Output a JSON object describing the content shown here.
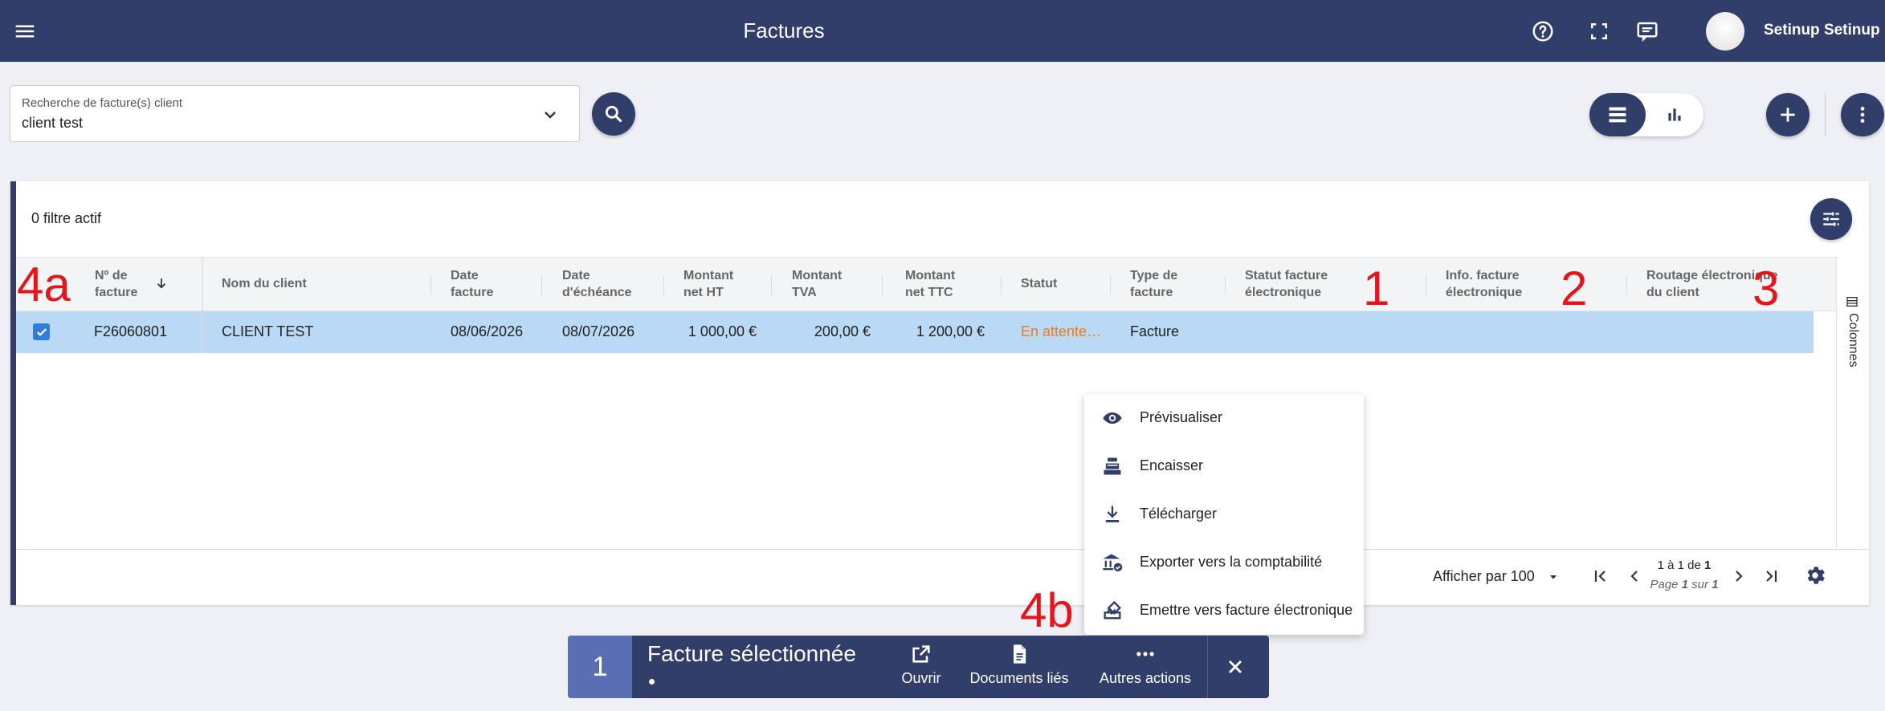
{
  "topbar": {
    "title": "Factures",
    "user_name": "Setinup Setinup",
    "icons": [
      "menu-icon",
      "help-icon",
      "fullscreen-icon",
      "chat-icon"
    ]
  },
  "search": {
    "label": "Recherche de facture(s) client",
    "value": "client test"
  },
  "filters": {
    "active_text": "0 filtre actif"
  },
  "table": {
    "headers": {
      "invoice_number": [
        "Nº de",
        "facture"
      ],
      "client_name": "Nom du client",
      "invoice_date": [
        "Date",
        "facture"
      ],
      "due_date": [
        "Date",
        "d'échéance"
      ],
      "amount_ht": [
        "Montant",
        "net HT"
      ],
      "amount_tva": [
        "Montant",
        "TVA"
      ],
      "amount_ttc": [
        "Montant",
        "net TTC"
      ],
      "status": "Statut",
      "invoice_type": [
        "Type de",
        "facture"
      ],
      "einvoice_status": [
        "Statut facture",
        "électronique"
      ],
      "einvoice_info": [
        "Info. facture",
        "électronique"
      ],
      "client_routing": [
        "Routage électronique",
        "du client"
      ]
    },
    "rows": [
      {
        "selected": true,
        "invoice_number": "F26060801",
        "client_name": "CLIENT TEST",
        "invoice_date": "08/06/2026",
        "due_date": "08/07/2026",
        "amount_ht": "1 000,00 €",
        "amount_tva": "200,00 €",
        "amount_ttc": "1 200,00 €",
        "status": "En attente…",
        "invoice_type": "Facture"
      }
    ],
    "columns_panel_label": "Colonnes"
  },
  "pagination": {
    "per_page_label": "Afficher par 100",
    "range_prefix": "1 à 1 de ",
    "range_total": "1",
    "page_prefix": "Page ",
    "page_current": "1",
    "page_mid": " sur ",
    "page_total": "1"
  },
  "annotations": {
    "m1": "1",
    "m2": "2",
    "m3": "3",
    "m4a": "4a",
    "m4b": "4b"
  },
  "context_menu": {
    "items": [
      {
        "label": "Prévisualiser",
        "icon": "eye-icon"
      },
      {
        "label": "Encaisser",
        "icon": "cash-register-icon"
      },
      {
        "label": "Télécharger",
        "icon": "download-icon"
      },
      {
        "label": "Exporter vers la comptabilité",
        "icon": "bank-check-icon"
      },
      {
        "label": "Emettre vers facture électronique",
        "icon": "send-einvoice-icon"
      }
    ]
  },
  "selection_bar": {
    "count": "1",
    "title": "Facture sélectionnée",
    "actions": {
      "open": "Ouvrir",
      "linked_docs": "Documents liés",
      "more": "Autres actions"
    }
  },
  "colors": {
    "primary": "#303e69",
    "selected_row": "#b9d9f5",
    "status_pending": "#f07a1a",
    "annotation_red": "#e3161b",
    "selection_count_bg": "#5a6fb1"
  }
}
